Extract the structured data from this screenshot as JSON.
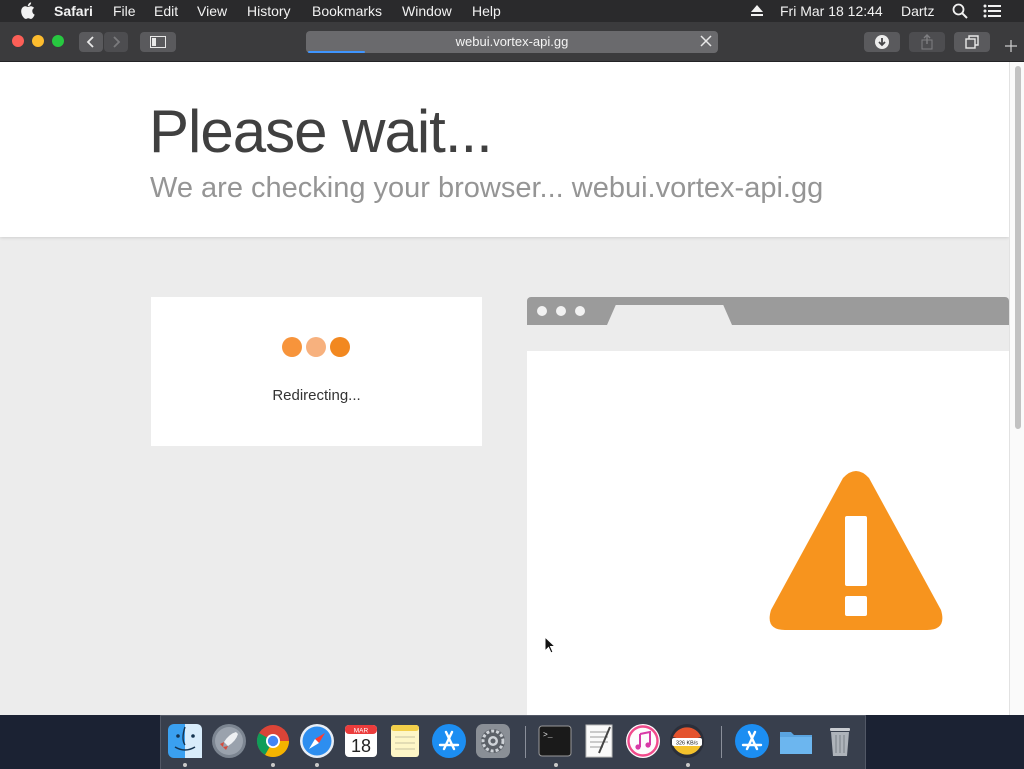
{
  "menubar": {
    "apple": "",
    "app_name": "Safari",
    "menus": [
      "File",
      "Edit",
      "View",
      "History",
      "Bookmarks",
      "Window",
      "Help"
    ],
    "clock": "Fri Mar 18  12:44",
    "user": "Dartz"
  },
  "toolbar": {
    "url": "webui.vortex-api.gg",
    "page_load_progress": 0.14
  },
  "page": {
    "title": "Please wait...",
    "subtitle": "We are checking your browser... webui.vortex-api.gg",
    "status": "Redirecting...",
    "loader_colors": [
      "#f7943b",
      "#f7b17e",
      "#f28820"
    ],
    "warning_color": "#f7941e"
  },
  "dock": {
    "calendar": {
      "month": "MAR",
      "day": "18"
    },
    "network_speed": "326 KB/s"
  },
  "colors": {
    "accent_blue": "#3f95ff",
    "close": "#fc5f57",
    "minimize": "#fdbc2e",
    "zoom": "#27c840"
  }
}
